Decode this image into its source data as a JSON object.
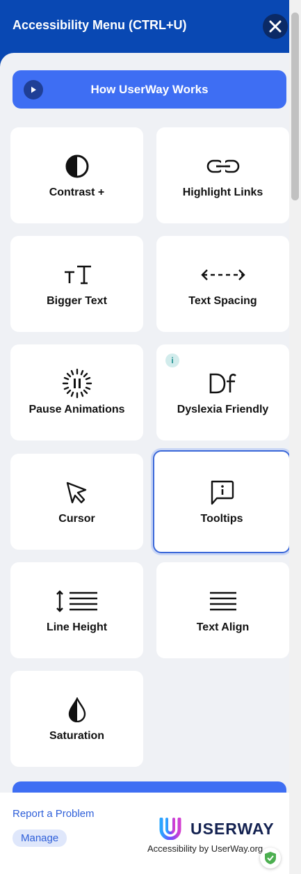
{
  "header": {
    "title": "Accessibility Menu (CTRL+U)",
    "close_icon": "close-icon"
  },
  "how_it_works": {
    "label": "How UserWay Works",
    "icon": "play-icon"
  },
  "tiles": [
    {
      "label": "Contrast +",
      "icon": "contrast-icon",
      "active": false
    },
    {
      "label": "Highlight Links",
      "icon": "link-icon",
      "active": false
    },
    {
      "label": "Bigger Text",
      "icon": "text-size-icon",
      "active": false
    },
    {
      "label": "Text Spacing",
      "icon": "text-spacing-icon",
      "active": false
    },
    {
      "label": "Pause Animations",
      "icon": "pause-animations-icon",
      "active": false
    },
    {
      "label": "Dyslexia Friendly",
      "icon": "dyslexia-font-icon",
      "active": false,
      "info_badge": "i"
    },
    {
      "label": "Cursor",
      "icon": "cursor-icon",
      "active": false
    },
    {
      "label": "Tooltips",
      "icon": "tooltip-icon",
      "active": true
    },
    {
      "label": "Line Height",
      "icon": "line-height-icon",
      "active": false
    },
    {
      "label": "Text Align",
      "icon": "text-align-icon",
      "active": false
    },
    {
      "label": "Saturation",
      "icon": "saturation-icon",
      "active": false
    }
  ],
  "footer": {
    "report_link": "Report a Problem",
    "manage_button": "Manage",
    "brand_name": "USERWAY",
    "brand_tagline": "Accessibility by UserWay.org"
  },
  "colors": {
    "header_bg": "#0948b3",
    "primary_button": "#3e6ef3",
    "panel_bg": "#eff1f5",
    "active_border": "#3a67d8",
    "link": "#2e5fd9"
  }
}
